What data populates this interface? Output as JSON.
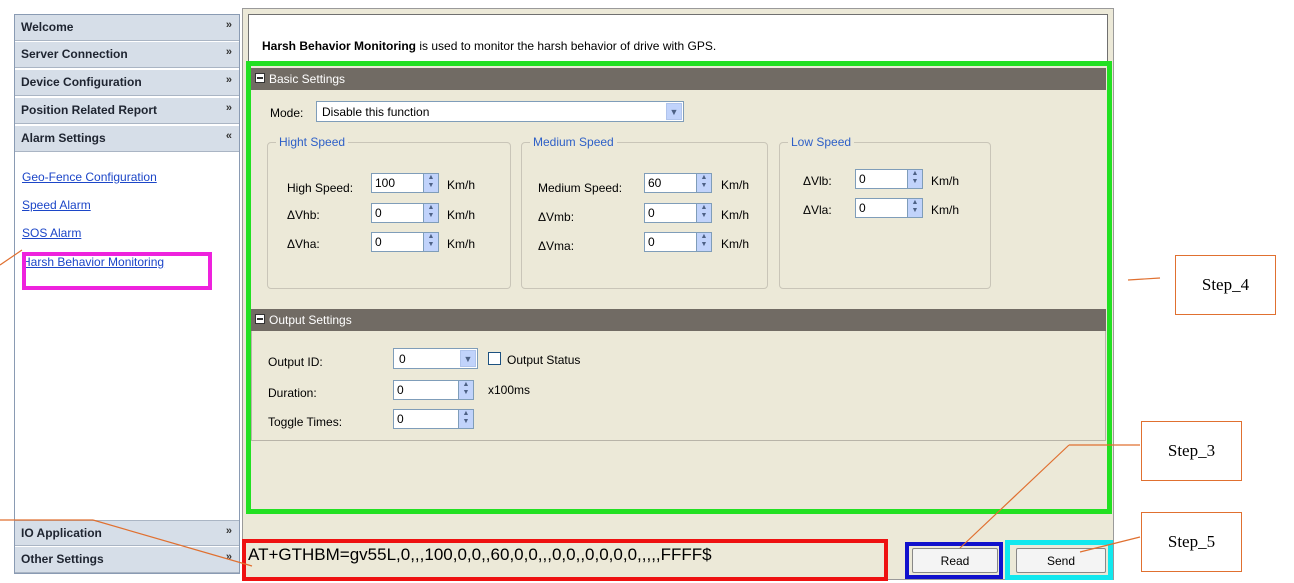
{
  "nav": {
    "sections_top": [
      {
        "label": "Welcome",
        "chevron": "»"
      },
      {
        "label": "Server Connection",
        "chevron": "»"
      },
      {
        "label": "Device Configuration",
        "chevron": "»"
      },
      {
        "label": "Position Related Report",
        "chevron": "»"
      },
      {
        "label": "Alarm Settings",
        "chevron": "«"
      }
    ],
    "alarm_links": [
      "Geo-Fence Configuration",
      "Speed Alarm",
      "SOS Alarm",
      "Harsh Behavior Monitoring"
    ],
    "sections_bottom": [
      {
        "label": "IO Application",
        "chevron": "»"
      },
      {
        "label": "Other Settings",
        "chevron": "»"
      }
    ]
  },
  "description": {
    "bold": "Harsh Behavior Monitoring",
    "rest": " is used to monitor the harsh behavior of drive with GPS."
  },
  "basic": {
    "title": "Basic Settings",
    "mode_label": "Mode:",
    "mode_value": "Disable this function",
    "high": {
      "title": "Hight Speed",
      "labels": [
        "High Speed:",
        "ΔVhb:",
        "ΔVha:"
      ],
      "values": [
        "100",
        "0",
        "0"
      ],
      "unit": "Km/h"
    },
    "medium": {
      "title": "Medium Speed",
      "labels": [
        "Medium Speed:",
        "ΔVmb:",
        "ΔVma:"
      ],
      "values": [
        "60",
        "0",
        "0"
      ],
      "unit": "Km/h"
    },
    "low": {
      "title": "Low Speed",
      "labels": [
        "ΔVlb:",
        "ΔVla:"
      ],
      "values": [
        "0",
        "0"
      ],
      "unit": "Km/h"
    }
  },
  "output": {
    "title": "Output Settings",
    "id_label": "Output ID:",
    "id_value": "0",
    "status_label": "Output Status",
    "duration_label": "Duration:",
    "duration_value": "0",
    "duration_unit": "x100ms",
    "toggle_label": "Toggle Times:",
    "toggle_value": "0"
  },
  "command": "AT+GTHBM=gv55L,0,,,100,0,0,,60,0,0,,,0,0,,0,0,0,0,,,,,FFFF$",
  "buttons": {
    "read": "Read",
    "send": "Send"
  },
  "annotations": {
    "step3": "Step_3",
    "step4": "Step_4",
    "step5": "Step_5"
  },
  "colors": {
    "green": "#22e022",
    "red": "#ee1111",
    "blue": "#1111cc",
    "cyan": "#11e8ee",
    "magenta": "#ee22dd",
    "orange": "#e07030"
  }
}
